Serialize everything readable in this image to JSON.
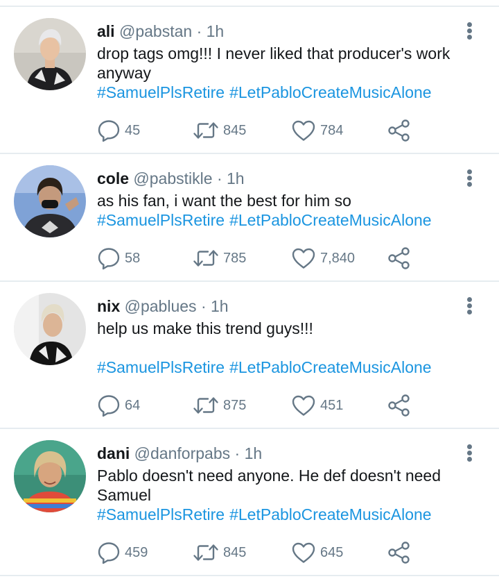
{
  "tweets": [
    {
      "name": "ali",
      "handle": "@pabstan",
      "sep": "·",
      "time": "1h",
      "text": "drop tags omg!!! I never liked that producer's work anyway",
      "hashtags": [
        "#SamuelPlsRetire",
        "#LetPabloCreateMusicAlone"
      ],
      "replies": "45",
      "retweets": "845",
      "likes": "784"
    },
    {
      "name": "cole",
      "handle": "@pabstikle",
      "sep": "·",
      "time": "1h",
      "text": "as his fan, i want the best for him so",
      "hashtags": [
        "#SamuelPlsRetire",
        "#LetPabloCreateMusicAlone"
      ],
      "replies": "58",
      "retweets": "785",
      "likes": "7,840"
    },
    {
      "name": "nix",
      "handle": "@pablues",
      "sep": "·",
      "time": "1h",
      "text": "help us make this trend guys!!!",
      "hashtags": [
        "#SamuelPlsRetire",
        "#LetPabloCreateMusicAlone"
      ],
      "replies": "64",
      "retweets": "875",
      "likes": "451"
    },
    {
      "name": "dani",
      "handle": "@danforpabs",
      "sep": "·",
      "time": "1h",
      "text": "Pablo doesn't need anyone. He def doesn't need Samuel",
      "hashtags": [
        "#SamuelPlsRetire",
        "#LetPabloCreateMusicAlone"
      ],
      "replies": "459",
      "retweets": "845",
      "likes": "645"
    }
  ],
  "icons": {
    "reply": "reply-icon",
    "retweet": "retweet-icon",
    "like": "heart-icon",
    "share": "share-icon",
    "more": "more-vertical-icon"
  },
  "colors": {
    "hashtag": "#1b95e0",
    "secondary_text": "#657786",
    "primary_text": "#14171a",
    "divider": "#e6ecf0"
  }
}
